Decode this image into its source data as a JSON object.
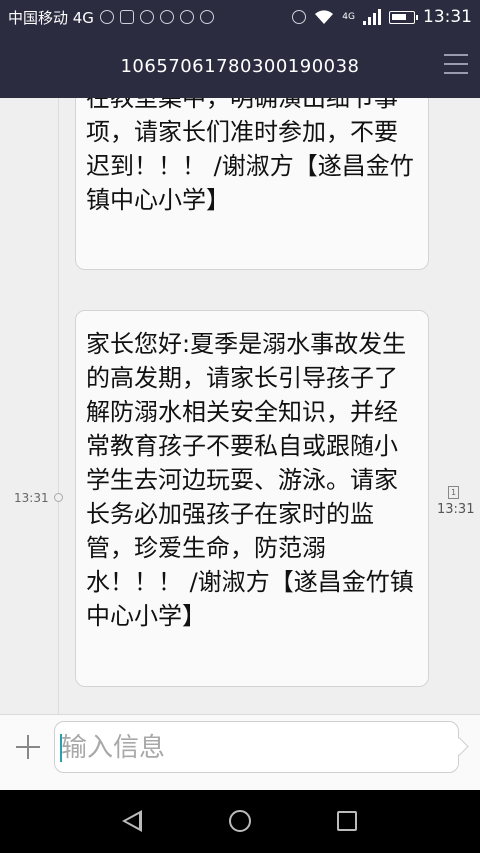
{
  "status_bar": {
    "carrier": "中国移动 4G",
    "network_label": "4G",
    "time": "13:31",
    "icons": [
      "wifi-call-icon",
      "image-icon",
      "browser-icon",
      "app-icon",
      "shield-icon",
      "refresh-icon",
      "alarm-icon",
      "wifi-icon",
      "signal-icon",
      "battery-icon"
    ]
  },
  "header": {
    "title": "10657061780300190038",
    "menu_icon": "menu-icon"
  },
  "conversation": {
    "messages": [
      {
        "text": "在教室集中，明确演出细节事项，请家长们准时参加，不要迟到！！！ /谢淑方【遂昌金竹镇中心小学】"
      },
      {
        "text": "家长您好:夏季是溺水事故发生的高发期，请家长引导孩子了解防溺水相关安全知识，并经常教育孩子不要私自或跟随小学生去河边玩耍、游泳。请家长务必加强孩子在家时的监管，珍爱生命，防范溺水！！！ /谢淑方【遂昌金竹镇中心小学】"
      }
    ],
    "time_left": "13:31",
    "sim_label": "1",
    "time_right": "13:31"
  },
  "input_bar": {
    "placeholder": "输入信息"
  },
  "nav_bar": {
    "icons": [
      "back-icon",
      "home-icon",
      "recents-icon"
    ]
  }
}
